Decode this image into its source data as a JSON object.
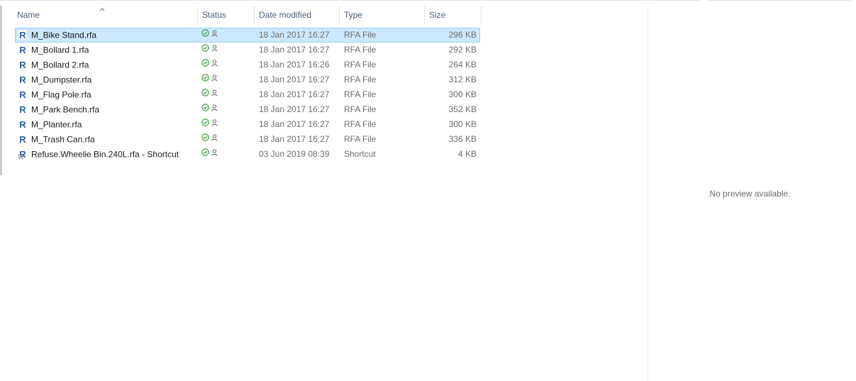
{
  "columns": {
    "name": "Name",
    "status": "Status",
    "date": "Date modified",
    "type": "Type",
    "size": "Size"
  },
  "files": [
    {
      "name": "M_Bike Stand.rfa",
      "date": "18 Jan 2017 16:27",
      "type": "RFA File",
      "size": "296 KB",
      "icon": "revit-family-icon",
      "selected": true
    },
    {
      "name": "M_Bollard 1.rfa",
      "date": "18 Jan 2017 16:27",
      "type": "RFA File",
      "size": "292 KB",
      "icon": "revit-family-icon"
    },
    {
      "name": "M_Bollard 2.rfa",
      "date": "18 Jan 2017 16:26",
      "type": "RFA File",
      "size": "264 KB",
      "icon": "revit-family-icon"
    },
    {
      "name": "M_Dumpster.rfa",
      "date": "18 Jan 2017 16:27",
      "type": "RFA File",
      "size": "312 KB",
      "icon": "revit-family-icon"
    },
    {
      "name": "M_Flag Pole.rfa",
      "date": "18 Jan 2017 16:27",
      "type": "RFA File",
      "size": "300 KB",
      "icon": "revit-family-icon"
    },
    {
      "name": "M_Park Bench.rfa",
      "date": "18 Jan 2017 16:27",
      "type": "RFA File",
      "size": "352 KB",
      "icon": "revit-family-icon"
    },
    {
      "name": "M_Planter.rfa",
      "date": "18 Jan 2017 16:27",
      "type": "RFA File",
      "size": "300 KB",
      "icon": "revit-family-icon"
    },
    {
      "name": "M_Trash Can.rfa",
      "date": "18 Jan 2017 16:27",
      "type": "RFA File",
      "size": "336 KB",
      "icon": "revit-family-icon"
    },
    {
      "name": "Refuse.Wheelie Bin.240L.rfa - Shortcut",
      "date": "03 Jun 2019 08:39",
      "type": "Shortcut",
      "size": "4 KB",
      "icon": "revit-shortcut-icon"
    }
  ],
  "status_icons": [
    "synced-check-icon",
    "shared-user-icon"
  ],
  "preview": {
    "message": "No preview available."
  },
  "colors": {
    "selection_bg": "#cce8ff",
    "selection_border": "#99d1ff",
    "header_text": "#4c607a",
    "revit_blue": "#2f5f9e",
    "status_green": "#3a9a3a"
  }
}
